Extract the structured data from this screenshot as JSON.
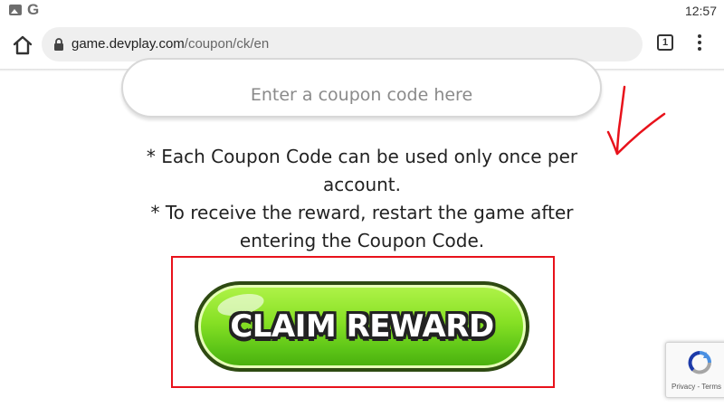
{
  "status_bar": {
    "time": "12:57",
    "icons": [
      "photo-icon",
      "google-icon"
    ],
    "google_glyph": "G"
  },
  "browser": {
    "url_host": "game.devplay.com",
    "url_path": "/coupon/ck/en",
    "tab_count": "1",
    "icons": [
      "home-icon",
      "lock-icon",
      "tab-switcher-icon",
      "overflow-menu-icon"
    ]
  },
  "coupon": {
    "placeholder": "Enter a coupon code here",
    "notes": [
      "* Each Coupon Code can be used only once per account.",
      "* To receive the reward, restart the game after entering the Coupon Code."
    ],
    "claim_button_label": "CLAIM REWARD"
  },
  "recaptcha": {
    "privacy": "Privacy",
    "separator": " - ",
    "terms": "Terms"
  },
  "colors": {
    "annotation_red": "#e8121b",
    "button_green": "#86e024",
    "button_outline": "#2e4a12"
  }
}
